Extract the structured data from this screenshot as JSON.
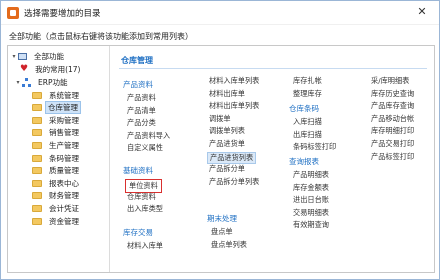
{
  "window": {
    "title": "选择需要增加的目录"
  },
  "hint": "全部功能（点击鼠标右键将该功能添加到常用列表）",
  "tree": {
    "root": "全部功能",
    "favorites": "我的常用(17)",
    "erp": "ERP功能",
    "modules": [
      "系统管理",
      "仓库管理",
      "采购管理",
      "销售管理",
      "生产管理",
      "条码管理",
      "质量管理",
      "报表中心",
      "财务管理",
      "会计凭证",
      "资金管理"
    ],
    "selected": "仓库管理"
  },
  "section": {
    "title": "仓库管理"
  },
  "groups": {
    "product": {
      "title": "产品资料",
      "items": [
        "产品资料",
        "产品清单",
        "产品分类",
        "产品资料导入",
        "自定义属性"
      ]
    },
    "base": {
      "title": "基础资料",
      "items": [
        "单位资料",
        "仓库资料",
        "出入库类型"
      ]
    },
    "trade": {
      "title": "库存交易",
      "items": [
        "材料入库单"
      ]
    },
    "col2": {
      "items": [
        "材料入库单列表",
        "材料出库单",
        "材料出库单列表",
        "调拨单",
        "调拨单列表",
        "产品进货单",
        "产品进货列表",
        "产品拆分单",
        "产品拆分单列表"
      ]
    },
    "period": {
      "title": "期末处理",
      "items": [
        "盘点单",
        "盘点单列表"
      ]
    },
    "col3a": {
      "items": [
        "库存扎帐",
        "整理库存"
      ]
    },
    "barcode": {
      "title": "仓库条码",
      "items": [
        "入库扫描",
        "出库扫描",
        "条码标签打印"
      ]
    },
    "query": {
      "title": "查询报表",
      "items": [
        "产品明细表",
        "库存金额表",
        "进出日台账",
        "交易明细表",
        "有效期查询"
      ]
    },
    "col4": {
      "items": [
        "采/库明细表",
        "库存历史查询",
        "产品库存查询",
        "产品移动台帐",
        "库存明细打印",
        "产品交易打印",
        "产品标签打印"
      ]
    }
  },
  "highlighted": "产品进货列表",
  "boxed": "单位资料"
}
